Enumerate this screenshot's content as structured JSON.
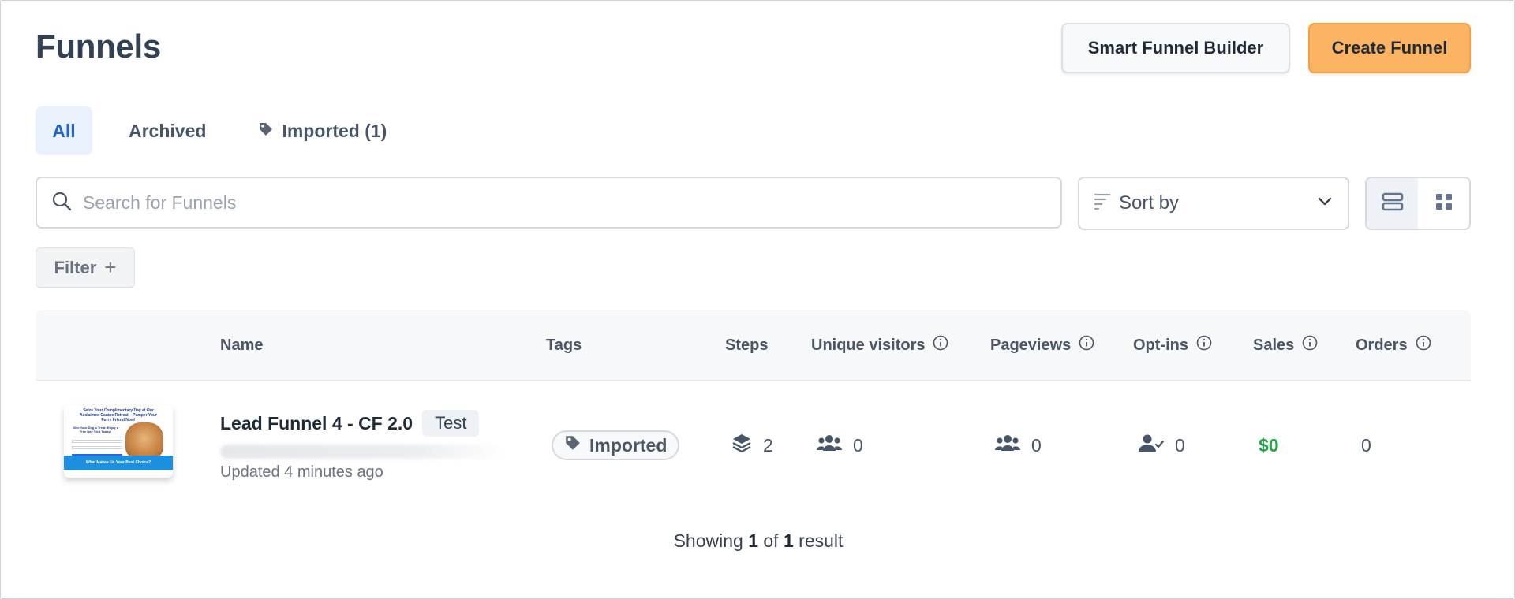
{
  "header": {
    "title": "Funnels",
    "smart_builder_label": "Smart Funnel Builder",
    "create_label": "Create Funnel"
  },
  "tabs": [
    {
      "label": "All",
      "active": true
    },
    {
      "label": "Archived",
      "active": false
    },
    {
      "label": "Imported (1)",
      "active": false,
      "icon": "tag-icon"
    }
  ],
  "search": {
    "placeholder": "Search for Funnels",
    "value": ""
  },
  "sort": {
    "label": "Sort by"
  },
  "view": {
    "active": "list"
  },
  "filter": {
    "label": "Filter",
    "plus": "+"
  },
  "table": {
    "columns": [
      "Name",
      "Tags",
      "Steps",
      "Unique visitors",
      "Pageviews",
      "Opt-ins",
      "Sales",
      "Orders"
    ],
    "rows": [
      {
        "thumbnail_title": "Seize Your Complimentary Day at Our Acclaimed Canine Retreat – Pamper Your Furry Friend Now!",
        "thumbnail_sub": "Give Your Dog a Treat: Enjoy a Free Day Visit Today!",
        "thumbnail_cta": "What Makes Us Your Best Choice?",
        "name": "Lead Funnel 4 - CF 2.0",
        "badge": "Test",
        "updated": "Updated 4 minutes ago",
        "tag": "Imported",
        "steps": "2",
        "unique_visitors": "0",
        "pageviews": "0",
        "optins": "0",
        "sales": "$0",
        "orders": "0"
      }
    ]
  },
  "footer": {
    "prefix": "Showing",
    "shown": "1",
    "of": "of",
    "total": "1",
    "suffix": "result"
  },
  "colors": {
    "accent": "#2563c8",
    "create_button": "#fbb463",
    "sales": "#22a546"
  }
}
